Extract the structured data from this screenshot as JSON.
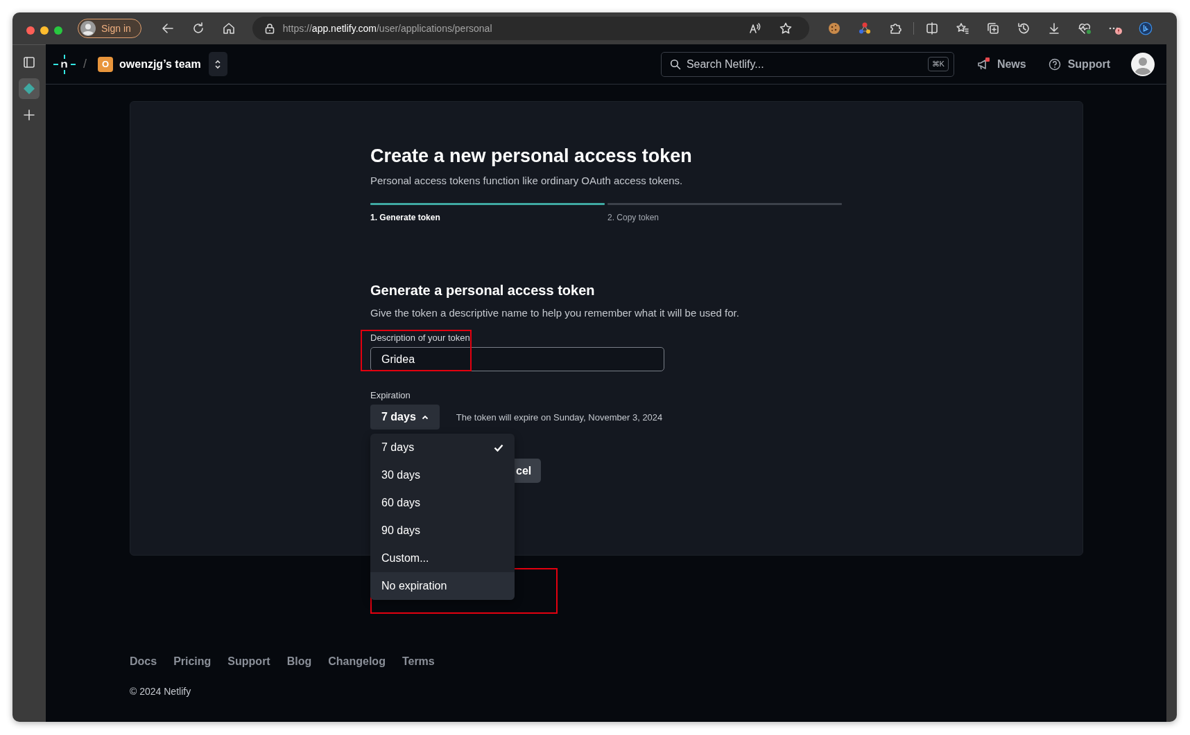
{
  "browser": {
    "sign_in": "Sign in",
    "url": [
      {
        "text": "https://",
        "kind": "dim"
      },
      {
        "text": "app.netlify.com",
        "kind": "host"
      },
      {
        "text": "/user/applications/personal",
        "kind": "dim"
      }
    ]
  },
  "sidebar": {
    "items": [
      {
        "kind": "tabs",
        "selected": false
      },
      {
        "kind": "app",
        "selected": true
      },
      {
        "kind": "add",
        "selected": false
      }
    ]
  },
  "header": {
    "separator": "/",
    "team_initial": "O",
    "team_name": "owenzjg’s team",
    "search": {
      "placeholder": "Search Netlify...",
      "shortcut": "⌘K"
    },
    "links": [
      {
        "kind": "news",
        "label": "News",
        "unread": true
      },
      {
        "kind": "support",
        "label": "Support",
        "unread": false
      }
    ]
  },
  "page": {
    "title": "Create a new personal access token",
    "subtitle": "Personal access tokens function like ordinary OAuth access tokens.",
    "steps": [
      {
        "label": "1. Generate token",
        "selected": true
      },
      {
        "label": "2. Copy token",
        "selected": false
      }
    ],
    "section": {
      "heading": "Generate a personal access token",
      "description": "Give the token a descriptive name to help you remember what it will be used for."
    },
    "token_field": {
      "label": "Description of your token",
      "value": "Gridea",
      "highlight": true
    },
    "expiration": {
      "label": "Expiration",
      "value": "7 days",
      "expanded": true,
      "note": "The token will expire on Sunday, November 3, 2024",
      "options": [
        {
          "label": "7 days",
          "selected": true,
          "hovered": false,
          "highlight": false
        },
        {
          "label": "30 days",
          "selected": false,
          "hovered": false,
          "highlight": false
        },
        {
          "label": "60 days",
          "selected": false,
          "hovered": false,
          "highlight": false
        },
        {
          "label": "90 days",
          "selected": false,
          "hovered": false,
          "highlight": false
        },
        {
          "label": "Custom...",
          "selected": false,
          "hovered": false,
          "highlight": false
        },
        {
          "label": "No expiration",
          "selected": false,
          "hovered": true,
          "highlight": true
        }
      ]
    },
    "buttons": [
      {
        "label": "cel"
      }
    ]
  },
  "footer": {
    "links": [
      "Docs",
      "Pricing",
      "Support",
      "Blog",
      "Changelog",
      "Terms"
    ],
    "copyright": "© 2024 Netlify"
  }
}
